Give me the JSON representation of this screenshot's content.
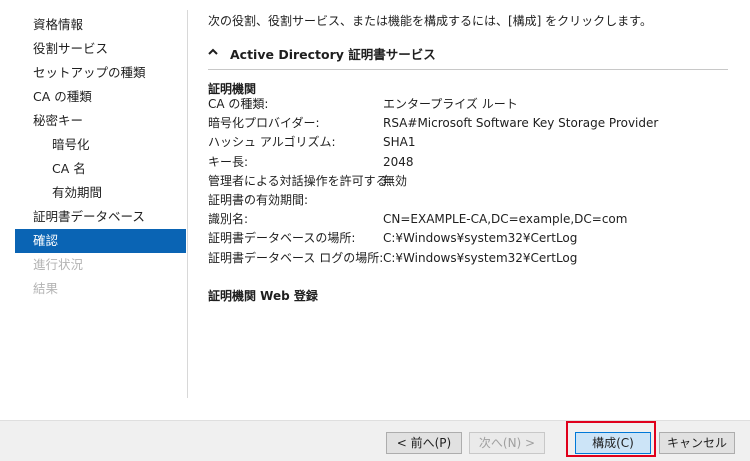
{
  "nav": {
    "items": [
      {
        "label": "資格情報",
        "state": "normal",
        "indent": false
      },
      {
        "label": "役割サービス",
        "state": "normal",
        "indent": false
      },
      {
        "label": "セットアップの種類",
        "state": "normal",
        "indent": false
      },
      {
        "label": "CA の種類",
        "state": "normal",
        "indent": false
      },
      {
        "label": "秘密キー",
        "state": "normal",
        "indent": false
      },
      {
        "label": "暗号化",
        "state": "normal",
        "indent": true
      },
      {
        "label": "CA 名",
        "state": "normal",
        "indent": true
      },
      {
        "label": "有効期間",
        "state": "normal",
        "indent": true
      },
      {
        "label": "証明書データベース",
        "state": "normal",
        "indent": false
      },
      {
        "label": "確認",
        "state": "active",
        "indent": false
      },
      {
        "label": "進行状況",
        "state": "disabled",
        "indent": false
      },
      {
        "label": "結果",
        "state": "disabled",
        "indent": false
      }
    ]
  },
  "content": {
    "instruction": "次の役割、役割サービス、または機能を構成するには、[構成] をクリックします。",
    "section_title": "Active Directory 証明書サービス",
    "group1": {
      "heading": "証明機関",
      "rows": [
        {
          "label": "CA の種類:",
          "value": "エンタープライズ ルート"
        },
        {
          "label": "暗号化プロバイダー:",
          "value": "RSA#Microsoft Software Key Storage Provider"
        },
        {
          "label": "ハッシュ アルゴリズム:",
          "value": "SHA1"
        },
        {
          "label": "キー長:",
          "value": "2048"
        },
        {
          "label": "管理者による対話操作を許可する:",
          "value": "無効"
        },
        {
          "label": "証明書の有効期間:",
          "value": ""
        },
        {
          "label": "識別名:",
          "value": "CN=EXAMPLE-CA,DC=example,DC=com"
        },
        {
          "label": "証明書データベースの場所:",
          "value": "C:¥Windows¥system32¥CertLog"
        },
        {
          "label": "証明書データベース ログの場所:",
          "value": "C:¥Windows¥system32¥CertLog"
        }
      ]
    },
    "group2": {
      "heading": "証明機関 Web 登録"
    }
  },
  "footer": {
    "prev_label": "< 前へ(P)",
    "next_label": "次へ(N) >",
    "configure_label": "構成(C)",
    "cancel_label": "キャンセル"
  },
  "colors": {
    "active_nav": "#0a64b4",
    "highlight_box": "#e0001b",
    "primary_button": "#cce4f7"
  },
  "icons": {
    "section_toggle": "chevron-up-icon"
  }
}
